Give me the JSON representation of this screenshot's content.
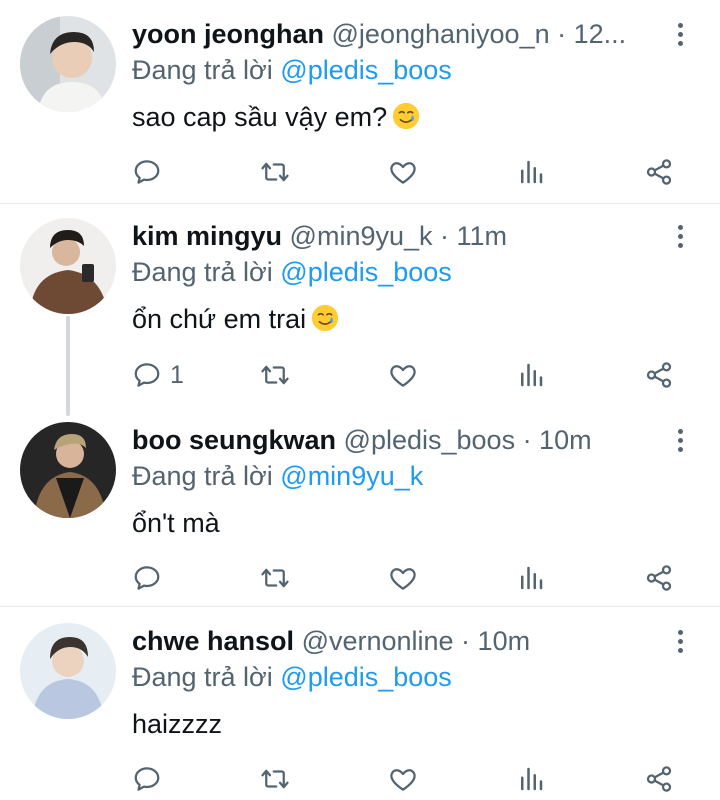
{
  "colors": {
    "text": "#0f1419",
    "secondary": "#536471",
    "link": "#1d9bf0",
    "divider": "#e6ecf0"
  },
  "tweets": [
    {
      "name": "yoon jeonghan",
      "meta": "@jeonghaniyoo_n · 12...",
      "reply_prefix": "Đang trả lời",
      "reply_to": "@pledis_boos",
      "text": "sao cap sầu vậy em?",
      "emoji": "smiling-face-with-tear-icon",
      "reply_count": ""
    },
    {
      "name": "kim mingyu",
      "meta": "@min9yu_k · 11m",
      "reply_prefix": "Đang trả lời",
      "reply_to": "@pledis_boos",
      "text": "ổn chứ em trai",
      "emoji": "smiling-face-with-tear-icon",
      "reply_count": "1"
    },
    {
      "name": "boo seungkwan",
      "meta": "@pledis_boos · 10m",
      "reply_prefix": "Đang trả lời",
      "reply_to": "@min9yu_k",
      "text": "ổn't mà",
      "emoji": "",
      "reply_count": ""
    },
    {
      "name": "chwe hansol",
      "meta": "@vernonline · 10m",
      "reply_prefix": "Đang trả lời",
      "reply_to": "@pledis_boos",
      "text": "haizzzz",
      "emoji": "",
      "reply_count": ""
    }
  ],
  "action_icons": [
    "reply-icon",
    "retweet-icon",
    "like-icon",
    "views-icon",
    "share-icon"
  ]
}
